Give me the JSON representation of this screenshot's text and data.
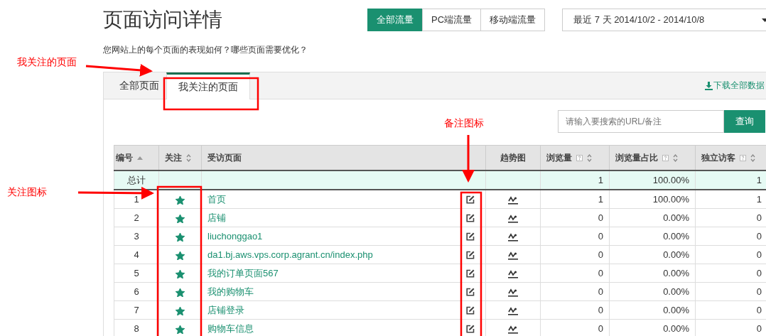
{
  "page_title": "页面访问详情",
  "traffic_tabs": [
    {
      "label": "全部流量",
      "selected": true
    },
    {
      "label": "PC端流量",
      "selected": false
    },
    {
      "label": "移动端流量",
      "selected": false
    }
  ],
  "date_range": "最近 7 天 2014/10/2 - 2014/10/8",
  "subtitle": "您网站上的每个页面的表现如何？哪些页面需要优化？",
  "page_tabs": [
    {
      "label": "全部页面",
      "selected": false
    },
    {
      "label": "我关注的页面",
      "selected": true
    }
  ],
  "download_link": "下载全部数据",
  "search": {
    "placeholder": "请输入要搜索的URL/备注",
    "button": "查询"
  },
  "table": {
    "columns": [
      {
        "label": "编号",
        "sortable": true,
        "sorted": true,
        "help": false
      },
      {
        "label": "关注",
        "sortable": true,
        "sorted": false,
        "help": false
      },
      {
        "label": "受访页面",
        "sortable": false,
        "sorted": false,
        "help": false
      },
      {
        "label": "趋势图",
        "sortable": false,
        "sorted": false,
        "help": false
      },
      {
        "label": "浏览量",
        "sortable": true,
        "sorted": false,
        "help": true
      },
      {
        "label": "浏览量占比",
        "sortable": true,
        "sorted": false,
        "help": true
      },
      {
        "label": "独立访客",
        "sortable": true,
        "sorted": false,
        "help": true
      }
    ],
    "total": {
      "label": "总计",
      "views": "1",
      "share": "100.00%",
      "visitors": "1"
    },
    "rows": [
      {
        "no": "1",
        "followed": true,
        "page": "首页",
        "views": "1",
        "share": "100.00%",
        "visitors": "1"
      },
      {
        "no": "2",
        "followed": true,
        "page": "店铺",
        "views": "0",
        "share": "0.00%",
        "visitors": "0"
      },
      {
        "no": "3",
        "followed": true,
        "page": "liuchonggao1",
        "views": "0",
        "share": "0.00%",
        "visitors": "0"
      },
      {
        "no": "4",
        "followed": true,
        "page": "da1.bj.aws.vps.corp.agrant.cn/index.php",
        "views": "0",
        "share": "0.00%",
        "visitors": "0"
      },
      {
        "no": "5",
        "followed": true,
        "page": "我的订单页面567",
        "views": "0",
        "share": "0.00%",
        "visitors": "0"
      },
      {
        "no": "6",
        "followed": true,
        "page": "我的购物车",
        "views": "0",
        "share": "0.00%",
        "visitors": "0"
      },
      {
        "no": "7",
        "followed": true,
        "page": "店铺登录",
        "views": "0",
        "share": "0.00%",
        "visitors": "0"
      },
      {
        "no": "8",
        "followed": true,
        "page": "购物车信息",
        "views": "0",
        "share": "0.00%",
        "visitors": "0"
      }
    ]
  },
  "annotations": [
    {
      "kind": "tab",
      "text": "我关注的页面"
    },
    {
      "kind": "follow",
      "text": "关注图标"
    },
    {
      "kind": "note",
      "text": "备注图标"
    }
  ]
}
